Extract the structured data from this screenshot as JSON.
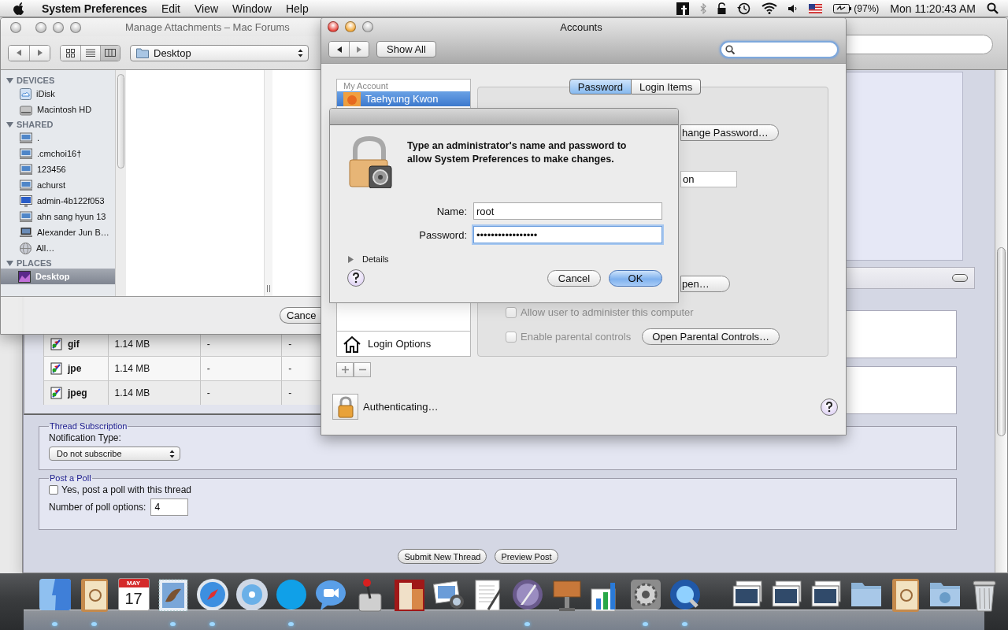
{
  "menu_bar": {
    "app_name": "System Preferences",
    "menus": [
      "Edit",
      "View",
      "Window",
      "Help"
    ],
    "battery": "(97%)",
    "clock": "Mon 11:20:43 AM"
  },
  "browser": {
    "attachments": [
      {
        "name": "gif",
        "size": "1.14 MB",
        "column_3": "-",
        "column_4": "-"
      },
      {
        "name": "jpe",
        "size": "1.14 MB",
        "column_3": "-",
        "column_4": "-"
      },
      {
        "name": "jpeg",
        "size": "1.14 MB",
        "column_3": "-",
        "column_4": "-"
      }
    ],
    "thread_subscription": {
      "legend": "Thread Subscription",
      "label": "Notification Type:",
      "value": "Do not subscribe"
    },
    "poll": {
      "legend": "Post a Poll",
      "checkbox_label": "Yes, post a poll with this thread",
      "checked": false,
      "options_label": "Number of poll options:",
      "options_value": "4"
    },
    "buttons": [
      "Submit New Thread",
      "Preview Post"
    ]
  },
  "finder": {
    "title": "Manage Attachments – Mac Forums",
    "view_modes": [
      {
        "kind": "icons",
        "selected": false
      },
      {
        "kind": "list",
        "selected": false
      },
      {
        "kind": "columns",
        "selected": true
      }
    ],
    "location": "Desktop",
    "sections": [
      {
        "title": "DEVICES",
        "expanded": true,
        "items": [
          {
            "label": "iDisk",
            "kind": "idisk",
            "selected": false
          },
          {
            "label": "Macintosh HD",
            "kind": "disk",
            "selected": false
          }
        ]
      },
      {
        "title": "SHARED",
        "expanded": true,
        "items": [
          {
            "label": ".",
            "kind": "computer",
            "selected": false
          },
          {
            "label": ".cmchoi16†",
            "kind": "computer",
            "selected": false
          },
          {
            "label": "123456",
            "kind": "computer",
            "selected": false
          },
          {
            "label": "achurst",
            "kind": "computer",
            "selected": false
          },
          {
            "label": "admin-4b122f053",
            "kind": "imac",
            "selected": false
          },
          {
            "label": "ahn sang hyun 13",
            "kind": "computer",
            "selected": false
          },
          {
            "label": "Alexander Jun B…",
            "kind": "laptop",
            "selected": false
          },
          {
            "label": "All…",
            "kind": "network",
            "selected": false
          }
        ]
      },
      {
        "title": "PLACES",
        "expanded": true,
        "items": [
          {
            "label": "Desktop",
            "kind": "desktop",
            "selected": true
          }
        ]
      }
    ],
    "cancel": "Cance"
  },
  "accounts": {
    "title": "Accounts",
    "show_all": "Show All",
    "list_header": "My Account",
    "users": [
      {
        "name": "Taehyung Kwon",
        "selected": true
      }
    ],
    "login_options": "Login Options",
    "tabs": [
      {
        "label": "Password",
        "selected": true
      },
      {
        "label": "Login Items",
        "selected": false
      }
    ],
    "change_password": "hange Password…",
    "field_value": "on",
    "open_button": "pen…",
    "checkboxes": [
      {
        "label": "Allow user to administer this computer",
        "checked": false,
        "disabled": true
      },
      {
        "label": "Enable parental controls",
        "checked": false,
        "disabled": true
      }
    ],
    "parental_button": "Open Parental Controls…",
    "status": "Authenticating…"
  },
  "auth_dialog": {
    "message": "Type an administrator's name and password to allow System Preferences to make changes.",
    "name_label": "Name:",
    "name_value": "root",
    "password_label": "Password:",
    "password_value": "•••••••••••••••••",
    "details": "Details",
    "details_expanded": false,
    "buttons": [
      {
        "label": "Cancel",
        "default": false
      },
      {
        "label": "OK",
        "default": true
      }
    ]
  },
  "dock": {
    "apps": [
      {
        "kind": "finder",
        "running": true
      },
      {
        "kind": "address-book",
        "running": true
      },
      {
        "kind": "calendar",
        "month": "MAY",
        "day": "17",
        "running": false
      },
      {
        "kind": "stamp",
        "running": true
      },
      {
        "kind": "safari",
        "running": true
      },
      {
        "kind": "itunes",
        "running": false
      },
      {
        "kind": "skype",
        "running": true
      },
      {
        "kind": "video-chat",
        "running": false
      },
      {
        "kind": "joystick",
        "running": false
      },
      {
        "kind": "photo-strip",
        "running": false
      },
      {
        "kind": "photos",
        "running": false
      },
      {
        "kind": "document",
        "running": false
      },
      {
        "kind": "quill",
        "running": true
      },
      {
        "kind": "podium",
        "running": false
      },
      {
        "kind": "chart",
        "running": false
      },
      {
        "kind": "gear",
        "running": true
      },
      {
        "kind": "player",
        "running": true
      }
    ],
    "documents": [
      {
        "kind": "stack",
        "running": false
      },
      {
        "kind": "stack",
        "running": false
      },
      {
        "kind": "stack",
        "running": false
      },
      {
        "kind": "folder",
        "running": false
      },
      {
        "kind": "address-book",
        "running": false
      },
      {
        "kind": "download-folder",
        "running": false
      },
      {
        "kind": "trash",
        "running": false
      }
    ]
  }
}
